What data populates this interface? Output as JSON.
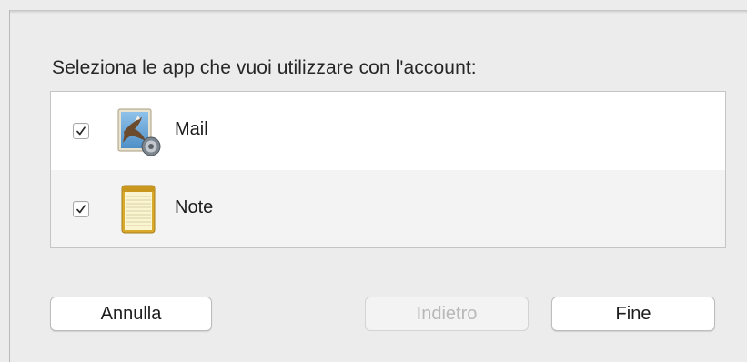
{
  "dialog": {
    "prompt": "Seleziona le app che vuoi utilizzare con l'account:"
  },
  "apps": [
    {
      "name": "Mail",
      "checked": true,
      "icon": "mail-icon"
    },
    {
      "name": "Note",
      "checked": true,
      "icon": "notes-icon"
    }
  ],
  "buttons": {
    "cancel_label": "Annulla",
    "back_label": "Indietro",
    "back_enabled": false,
    "done_label": "Fine"
  },
  "colors": {
    "window_bg": "#ececec",
    "list_bg": "#ffffff",
    "list_alt_row_bg": "#f3f3f3",
    "disabled_text": "#b8b8b8"
  }
}
